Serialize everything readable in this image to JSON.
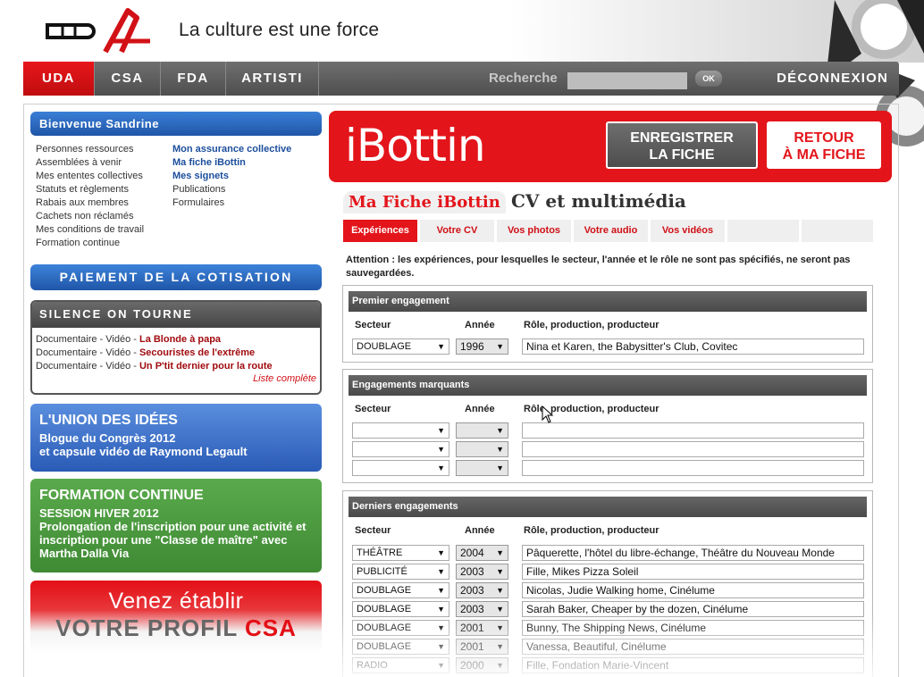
{
  "header": {
    "logo_text": "UDA",
    "tagline": "La culture est une force"
  },
  "nav": {
    "tabs": [
      "UDA",
      "CSA",
      "FDA",
      "ARTISTI"
    ],
    "active": "UDA",
    "search_label": "Recherche",
    "search_value": "",
    "ok_label": "OK",
    "logout_label": "DÉCONNEXION"
  },
  "welcome": {
    "title": "Bienvenue Sandrine",
    "col1": [
      "Personnes ressources",
      "Assemblées à venir",
      "Mes ententes collectives",
      "Statuts et règlements",
      "Rabais aux membres",
      "Cachets non réclamés",
      "Mes conditions de travail",
      "Formation continue"
    ],
    "col2_bold": [
      "Mon assurance collective",
      "Ma fiche iBottin",
      "Mes signets"
    ],
    "col2": [
      "Publications",
      "Formulaires"
    ]
  },
  "payment_button": "PAIEMENT DE LA COTISATION",
  "silence": {
    "title": "SILENCE ON TOURNE",
    "items": [
      {
        "prefix": "Documentaire - Vidéo - ",
        "title": "La Blonde à papa"
      },
      {
        "prefix": "Documentaire - Vidéo - ",
        "title": "Secouristes de l'extrême"
      },
      {
        "prefix": "Documentaire - Vidéo - ",
        "title": "Un P'tit dernier pour la route"
      }
    ],
    "more": "Liste complète"
  },
  "union": {
    "title": "L'UNION DES IDÉES",
    "line1": "Blogue du Congrès 2012",
    "line2": "et capsule vidéo de Raymond Legault"
  },
  "formation": {
    "title": "FORMATION CONTINUE",
    "line1": "SESSION HIVER 2012",
    "line2": "Prolongation de l'inscription pour une activité et inscription pour une \"Classe de maître\" avec Martha Dalla Via"
  },
  "csa_promo": {
    "line1": "Venez établir",
    "line2a": "VOTRE PROFIL ",
    "line2b": "CSA"
  },
  "ibottin": {
    "logo": "iBottin",
    "save_line1": "ENREGISTRER",
    "save_line2": "LA FICHE",
    "back_line1": "RETOUR",
    "back_line2": "À MA FICHE"
  },
  "page": {
    "title": "Ma Fiche iBottin",
    "subtitle": "CV et multimédia"
  },
  "subtabs": [
    "Expériences",
    "Votre CV",
    "Vos photos",
    "Votre audio",
    "Vos vidéos"
  ],
  "warning": "Attention : les expériences, pour lesquelles le secteur, l'année et le rôle ne sont pas spécifiés, ne seront pas sauvegardées.",
  "columns": {
    "sector": "Secteur",
    "year": "Année",
    "role": "Rôle, production, producteur"
  },
  "sections": {
    "first": {
      "title": "Premier engagement",
      "rows": [
        {
          "sector": "DOUBLAGE",
          "year": "1996",
          "role": "Nina et Karen, the Babysitter's Club, Covitec"
        }
      ]
    },
    "notable": {
      "title": "Engagements marquants",
      "rows": [
        {
          "sector": "",
          "year": "",
          "role": ""
        },
        {
          "sector": "",
          "year": "",
          "role": ""
        },
        {
          "sector": "",
          "year": "",
          "role": ""
        }
      ]
    },
    "last": {
      "title": "Derniers engagements",
      "rows": [
        {
          "sector": "THÉÂTRE",
          "year": "2004",
          "role": "Pâquerette, l'hôtel du libre-échange, Théâtre du Nouveau Monde"
        },
        {
          "sector": "PUBLICITÉ",
          "year": "2003",
          "role": "Fille, Mikes Pizza Soleil"
        },
        {
          "sector": "DOUBLAGE",
          "year": "2003",
          "role": "Nicolas, Judie Walking home, Cinélume"
        },
        {
          "sector": "DOUBLAGE",
          "year": "2003",
          "role": "Sarah Baker, Cheaper by the dozen, Cinélume"
        },
        {
          "sector": "DOUBLAGE",
          "year": "2001",
          "role": "Bunny, The Shipping News, Cinélume"
        },
        {
          "sector": "DOUBLAGE",
          "year": "2001",
          "role": "Vanessa, Beautiful, Cinélume"
        },
        {
          "sector": "RADIO",
          "year": "2000",
          "role": "Fille, Fondation Marie-Vincent"
        }
      ]
    }
  },
  "colors": {
    "red": "#e3151b",
    "blue": "#1f56a8",
    "green": "#4a9a3d",
    "gray": "#555555"
  }
}
